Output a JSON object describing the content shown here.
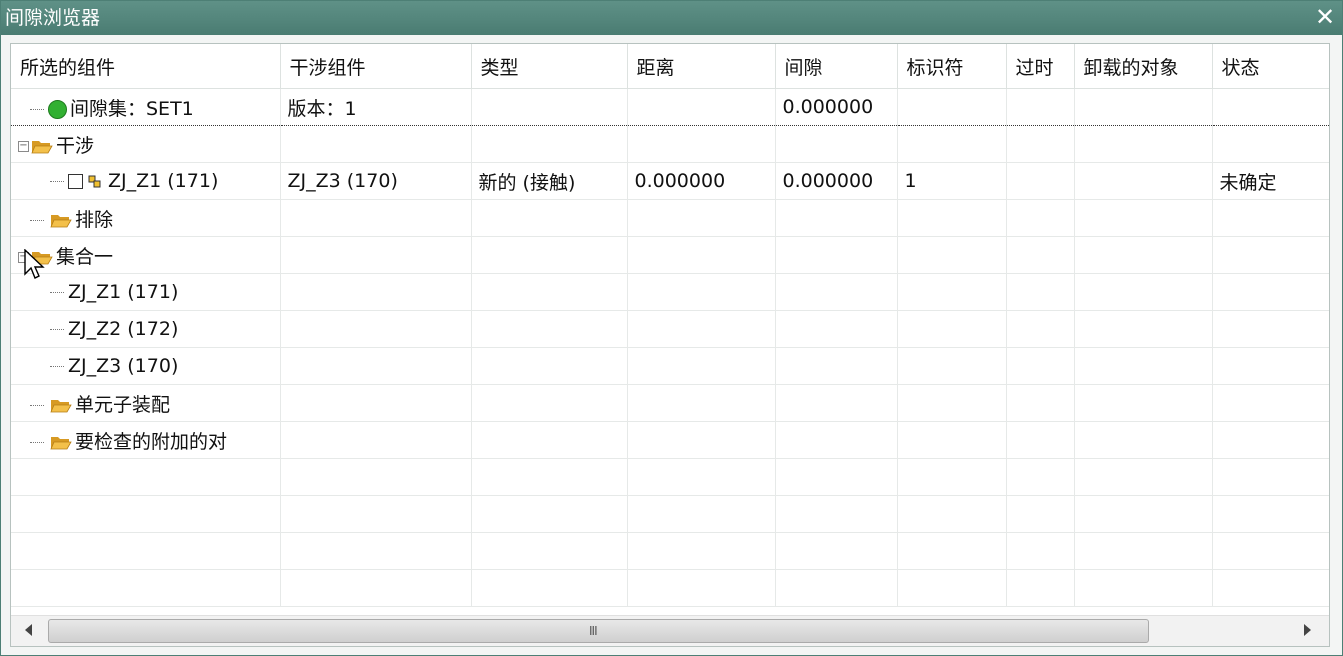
{
  "window": {
    "title": "间隙浏览器",
    "close_glyph": "✕"
  },
  "columns": [
    "所选的组件",
    "干涉组件",
    "类型",
    "距离",
    "间隙",
    "标识符",
    "过时",
    "卸载的对象",
    "状态"
  ],
  "rows": [
    {
      "name": "间隙集：SET1",
      "icon": "green-circle-icon",
      "c1": "版本：1",
      "c2": "",
      "c3": "",
      "c4": "0.000000",
      "c5": "",
      "c6": "",
      "c7": "",
      "c8": ""
    },
    {
      "name": "干涉",
      "icon": "folder-icon",
      "expander": "−",
      "c1": "",
      "c2": "",
      "c3": "",
      "c4": "",
      "c5": "",
      "c6": "",
      "c7": "",
      "c8": ""
    },
    {
      "name": "ZJ_Z1 (171)",
      "icon": "component-icon",
      "c1": "ZJ_Z3 (170)",
      "c2": "新的 (接触)",
      "c3": "0.000000",
      "c4": "0.000000",
      "c5": "1",
      "c6": "",
      "c7": "",
      "c8": "未确定"
    },
    {
      "name": "排除",
      "icon": "folder-icon"
    },
    {
      "name": "集合一",
      "icon": "folder-icon",
      "expander": "−"
    },
    {
      "name": "ZJ_Z1 (171)"
    },
    {
      "name": "ZJ_Z2 (172)"
    },
    {
      "name": "ZJ_Z3 (170)"
    },
    {
      "name": "单元子装配",
      "icon": "folder-icon"
    },
    {
      "name": "要检查的附加的对",
      "icon": "folder-icon"
    }
  ],
  "scrollbar": {
    "grip": "III"
  },
  "colors": {
    "titlebar": "#4f8178",
    "folder": "#f0b83a",
    "green": "#32b032"
  }
}
